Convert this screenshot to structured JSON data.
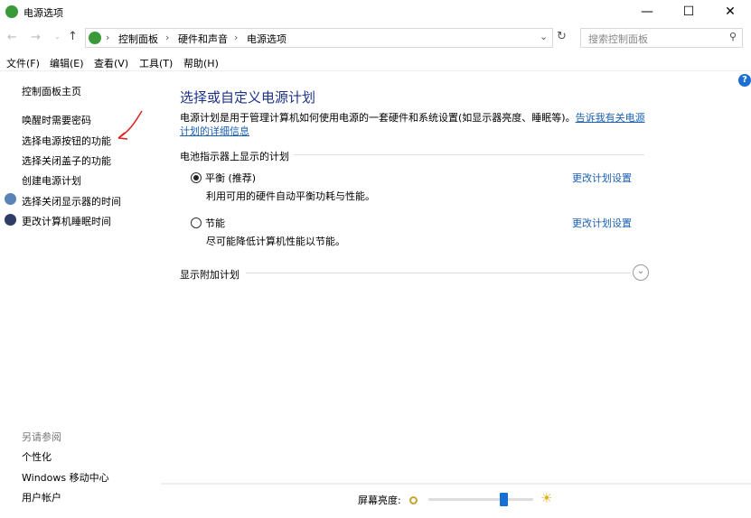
{
  "window": {
    "title": "电源选项",
    "minimize": "—",
    "maximize": "☐",
    "close": "✕"
  },
  "address": {
    "breadcrumbs": [
      "控制面板",
      "硬件和声音",
      "电源选项"
    ],
    "search_placeholder": "搜索控制面板"
  },
  "menu": [
    "文件(F)",
    "编辑(E)",
    "查看(V)",
    "工具(T)",
    "帮助(H)"
  ],
  "sidebar": {
    "home": "控制面板主页",
    "items": [
      "唤醒时需要密码",
      "选择电源按钮的功能",
      "选择关闭盖子的功能",
      "创建电源计划",
      "选择关闭显示器的时间",
      "更改计算机睡眠时间"
    ],
    "see_also": "另请参阅",
    "see_also_items": [
      "个性化",
      "Windows 移动中心",
      "用户帐户"
    ]
  },
  "main": {
    "title": "选择或自定义电源计划",
    "description": "电源计划是用于管理计算机如何使用电源的一套硬件和系统设置(如显示器亮度、睡眠等)。",
    "link_part1": "告诉我有关电源计",
    "link_part2": "划的详细信息",
    "group_label": "电池指示器上显示的计划",
    "plans": [
      {
        "name": "平衡 (推荐)",
        "desc": "利用可用的硬件自动平衡功耗与性能。",
        "change": "更改计划设置",
        "selected": true
      },
      {
        "name": "节能",
        "desc": "尽可能降低计算机性能以节能。",
        "change": "更改计划设置",
        "selected": false
      }
    ],
    "more_plans": "显示附加计划"
  },
  "brightness": {
    "label": "屏幕亮度:",
    "value_percent": 72
  },
  "help": "?"
}
